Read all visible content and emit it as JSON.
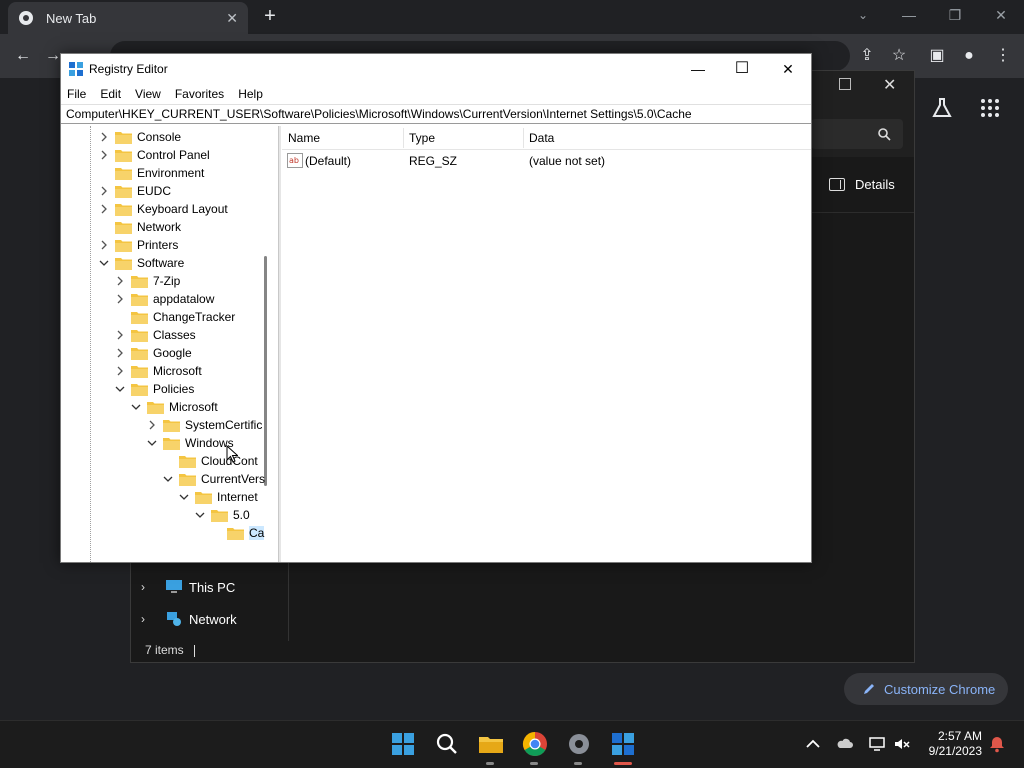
{
  "chrome": {
    "tab_title": "New Tab",
    "tab_close": "✕",
    "new_tab": "+",
    "minimize": "—",
    "restore": "❐",
    "close": "✕",
    "customize_label": "Customize Chrome"
  },
  "explorer": {
    "details_label": "Details",
    "nav": [
      {
        "label": "This PC"
      },
      {
        "label": "Network"
      }
    ],
    "status": "7 items"
  },
  "regedit": {
    "title": "Registry Editor",
    "minimize": "—",
    "maximize": "☐",
    "close": "✕",
    "menu": [
      "File",
      "Edit",
      "View",
      "Favorites",
      "Help"
    ],
    "address": "Computer\\HKEY_CURRENT_USER\\Software\\Policies\\Microsoft\\Windows\\CurrentVersion\\Internet Settings\\5.0\\Cache",
    "tree": [
      {
        "label": "Console",
        "depth": 0,
        "state": "collapsed"
      },
      {
        "label": "Control Panel",
        "depth": 0,
        "state": "collapsed"
      },
      {
        "label": "Environment",
        "depth": 0,
        "state": "none"
      },
      {
        "label": "EUDC",
        "depth": 0,
        "state": "collapsed"
      },
      {
        "label": "Keyboard Layout",
        "depth": 0,
        "state": "collapsed"
      },
      {
        "label": "Network",
        "depth": 0,
        "state": "none"
      },
      {
        "label": "Printers",
        "depth": 0,
        "state": "collapsed"
      },
      {
        "label": "Software",
        "depth": 0,
        "state": "expanded"
      },
      {
        "label": "7-Zip",
        "depth": 1,
        "state": "collapsed"
      },
      {
        "label": "appdatalow",
        "depth": 1,
        "state": "collapsed"
      },
      {
        "label": "ChangeTracker",
        "depth": 1,
        "state": "none"
      },
      {
        "label": "Classes",
        "depth": 1,
        "state": "collapsed"
      },
      {
        "label": "Google",
        "depth": 1,
        "state": "collapsed"
      },
      {
        "label": "Microsoft",
        "depth": 1,
        "state": "collapsed"
      },
      {
        "label": "Policies",
        "depth": 1,
        "state": "expanded"
      },
      {
        "label": "Microsoft",
        "depth": 2,
        "state": "expanded"
      },
      {
        "label": "SystemCertific",
        "depth": 3,
        "state": "collapsed"
      },
      {
        "label": "Windows",
        "depth": 3,
        "state": "expanded"
      },
      {
        "label": "CloudCont",
        "depth": 4,
        "state": "none"
      },
      {
        "label": "CurrentVers",
        "depth": 4,
        "state": "expanded"
      },
      {
        "label": "Internet",
        "depth": 5,
        "state": "expanded"
      },
      {
        "label": "5.0",
        "depth": 6,
        "state": "expanded"
      },
      {
        "label": "Ca",
        "depth": 7,
        "state": "none",
        "selected": true
      }
    ],
    "columns": [
      "Name",
      "Type",
      "Data"
    ],
    "rows": [
      {
        "name": "(Default)",
        "type": "REG_SZ",
        "data": "(value not set)"
      }
    ]
  },
  "taskbar": {
    "time": "2:57 AM",
    "date": "9/21/2023"
  },
  "colors": {
    "folder": "#f4c542",
    "selection": "#cce8ff",
    "accent": "#8ab4f8"
  }
}
